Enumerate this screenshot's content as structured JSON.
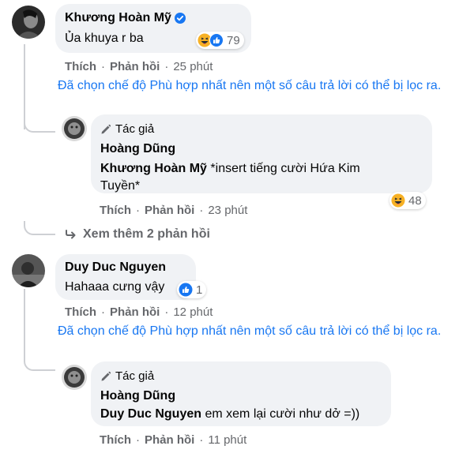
{
  "comments": [
    {
      "author": "Khương Hoàn Mỹ",
      "text": "Ủa khuya r ba",
      "reaction_count": "79",
      "actions": {
        "like": "Thích",
        "reply": "Phản hồi",
        "time": "25 phút"
      },
      "notice": "Đã chọn chế độ Phù hợp nhất nên một số câu trả lời có thể bị lọc ra.",
      "reply": {
        "tag": "Tác giả",
        "author": "Hoàng Dũng",
        "mention": "Khương Hoàn Mỹ",
        "text_line1": "*insert tiếng cười Hứa Kim",
        "text_line2": "Tuyền*",
        "reaction_count": "48",
        "actions": {
          "like": "Thích",
          "reply": "Phản hồi",
          "time": "23 phút"
        }
      },
      "more_replies": "Xem thêm 2 phản hồi"
    },
    {
      "author": "Duy Duc Nguyen",
      "text": "Hahaaa cưng vậy",
      "reaction_count": "1",
      "actions": {
        "like": "Thích",
        "reply": "Phản hồi",
        "time": "12 phút"
      },
      "notice": "Đã chọn chế độ Phù hợp nhất nên một số câu trả lời có thể bị lọc ra.",
      "reply": {
        "tag": "Tác giả",
        "author": "Hoàng Dũng",
        "mention": "Duy Duc Nguyen",
        "text": "em xem lại cười như dở =))",
        "actions": {
          "like": "Thích",
          "reply": "Phản hồi",
          "time": "11 phút"
        }
      }
    }
  ],
  "colors": {
    "link_blue": "#1877f2",
    "bubble_gray": "#f0f2f5",
    "meta_gray": "#65676b",
    "like_blue": "#1877f2",
    "haha_yellow": "#f7b125"
  },
  "icons": [
    "verified-badge-icon",
    "haha-reaction-icon",
    "like-reaction-icon",
    "pencil-icon",
    "reply-arrow-icon"
  ]
}
